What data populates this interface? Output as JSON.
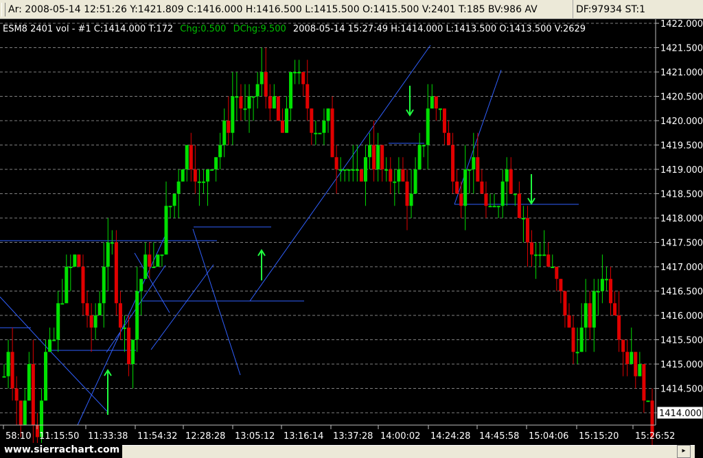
{
  "info_bar": [
    "Ar: 2008-05-14  12:51:26  Y:1421.809  C:1416.000  H:1416.500  L:1415.500  O:1415.500  V:2401  T:185  BV:986  AV",
    "DF:97934  ST:1"
  ],
  "chart_header": {
    "symbol": "ESM8  2401 vol - #1  C:1414.000  T:172",
    "chg": "Chg:0.500",
    "dchg": "DChg:9.500",
    "rest": "2008-05-14   15:27:49  H:1414.000  L:1413.500  O:1413.500  V:2629"
  },
  "watermark": "www.sierrachart.com",
  "colors": {
    "up": "#00e000",
    "down": "#e00000",
    "trendline": "#3060ff",
    "grid": "#808080",
    "text": "#ffffff",
    "header_green": "#00c000",
    "arrow": "#20ff40"
  },
  "chart_data": {
    "type": "candlestick",
    "price_axis_ticks": [
      "1422.000",
      "1421.500",
      "1421.000",
      "1420.500",
      "1420.000",
      "1419.500",
      "1419.000",
      "1418.500",
      "1418.000",
      "1417.500",
      "1417.000",
      "1416.500",
      "1416.000",
      "1415.500",
      "1415.000",
      "1414.500",
      "1414.000"
    ],
    "current_price_label": "1414.000",
    "time_labels": [
      "58:10",
      "11:15:50",
      "11:33:38",
      "11:54:32",
      "12:28:28",
      "13:05:12",
      "13:16:14",
      "13:37:28",
      "14:00:02",
      "14:24:28",
      "14:45:58",
      "15:04:06",
      "15:15:20",
      "15:26:52"
    ],
    "ylim": [
      1413.625,
      1422.0
    ],
    "bar_count": 157,
    "price_path": [
      [
        0,
        1414.75
      ],
      [
        4,
        1415.5
      ],
      [
        9,
        1414.5
      ],
      [
        15,
        1413.75
      ],
      [
        21,
        1415.25
      ],
      [
        25,
        1414.0
      ],
      [
        27,
        1414.5
      ],
      [
        29,
        1413.75
      ],
      [
        36,
        1415.25
      ],
      [
        44,
        1415.5
      ],
      [
        49,
        1416.25
      ],
      [
        55,
        1417.0
      ],
      [
        63,
        1417.25
      ],
      [
        73,
        1415.5
      ],
      [
        79,
        1416.0
      ],
      [
        86,
        1417.0
      ],
      [
        94,
        1417.5
      ],
      [
        99,
        1416.0
      ],
      [
        105,
        1415.75
      ],
      [
        109,
        1415.0
      ],
      [
        115,
        1416.5
      ],
      [
        120,
        1417.0
      ],
      [
        128,
        1417.25
      ],
      [
        131,
        1416.75
      ],
      [
        138,
        1417.75
      ],
      [
        149,
        1418.75
      ],
      [
        159,
        1419.5
      ],
      [
        170,
        1418.75
      ],
      [
        183,
        1419.25
      ],
      [
        191,
        1419.75
      ],
      [
        199,
        1420.5
      ],
      [
        209,
        1420.0
      ],
      [
        220,
        1420.75
      ],
      [
        230,
        1420.5
      ],
      [
        239,
        1420.0
      ],
      [
        244,
        1419.5
      ],
      [
        246,
        1421.0
      ],
      [
        251,
        1421.25
      ],
      [
        256,
        1420.75
      ],
      [
        264,
        1420.0
      ],
      [
        272,
        1419.75
      ],
      [
        279,
        1420.25
      ],
      [
        287,
        1419.25
      ],
      [
        298,
        1419.0
      ],
      [
        306,
        1418.75
      ],
      [
        315,
        1419.5
      ],
      [
        323,
        1419.25
      ],
      [
        331,
        1418.75
      ],
      [
        341,
        1419.0
      ],
      [
        353,
        1418.25
      ],
      [
        361,
        1419.5
      ],
      [
        369,
        1420.5
      ],
      [
        377,
        1420.25
      ],
      [
        385,
        1419.5
      ],
      [
        394,
        1418.5
      ],
      [
        404,
        1419.25
      ],
      [
        413,
        1418.5
      ],
      [
        420,
        1418.0
      ],
      [
        427,
        1418.5
      ],
      [
        433,
        1419.0
      ],
      [
        442,
        1418.75
      ],
      [
        449,
        1418.0
      ],
      [
        457,
        1417.25
      ],
      [
        467,
        1417.25
      ],
      [
        477,
        1416.75
      ],
      [
        486,
        1416.0
      ],
      [
        494,
        1415.25
      ],
      [
        504,
        1416.0
      ],
      [
        511,
        1416.25
      ],
      [
        518,
        1417.0
      ],
      [
        526,
        1416.5
      ],
      [
        535,
        1415.5
      ],
      [
        546,
        1415.0
      ],
      [
        553,
        1414.5
      ],
      [
        561,
        1413.75
      ]
    ],
    "price_path_x_units": "bar index scaled 0-561 across plot width",
    "trendlines_note": "blue support/resistance and trend lines",
    "signal_arrows": [
      {
        "direction": "up",
        "price": 1415.0
      },
      {
        "direction": "up",
        "price": 1417.25
      },
      {
        "direction": "down",
        "price": 1420.5
      },
      {
        "direction": "down",
        "price": 1418.75
      }
    ],
    "grid": "horizontal dashed",
    "legend": "none"
  }
}
